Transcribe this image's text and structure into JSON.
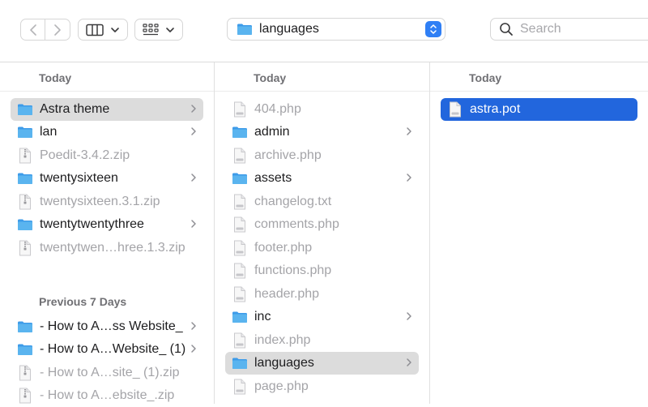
{
  "toolbar": {
    "path_label": "languages",
    "search_placeholder": "Search"
  },
  "columns": [
    {
      "header": "Today",
      "group_title": "Previous 7 Days",
      "items": [
        {
          "label": "Astra theme",
          "type": "folder"
        },
        {
          "label": "lan",
          "type": "folder"
        },
        {
          "label": "Poedit-3.4.2.zip",
          "type": "zip"
        },
        {
          "label": "twentysixteen",
          "type": "folder"
        },
        {
          "label": "twentysixteen.3.1.zip",
          "type": "zip"
        },
        {
          "label": "twentytwentythree",
          "type": "folder"
        },
        {
          "label": "twentytwen…hree.1.3.zip",
          "type": "zip"
        },
        {
          "label": "- How to A…ss Website_",
          "type": "folder"
        },
        {
          "label": "- How to A…Website_ (1)",
          "type": "folder"
        },
        {
          "label": "- How to A…site_ (1).zip",
          "type": "zip"
        },
        {
          "label": "- How to A…ebsite_.zip",
          "type": "zip"
        }
      ]
    },
    {
      "header": "Today",
      "items": [
        {
          "label": "404.php",
          "type": "file"
        },
        {
          "label": "admin",
          "type": "folder"
        },
        {
          "label": "archive.php",
          "type": "file"
        },
        {
          "label": "assets",
          "type": "folder"
        },
        {
          "label": "changelog.txt",
          "type": "file"
        },
        {
          "label": "comments.php",
          "type": "file"
        },
        {
          "label": "footer.php",
          "type": "file"
        },
        {
          "label": "functions.php",
          "type": "file"
        },
        {
          "label": "header.php",
          "type": "file"
        },
        {
          "label": "inc",
          "type": "folder"
        },
        {
          "label": "index.php",
          "type": "file"
        },
        {
          "label": "languages",
          "type": "folder"
        },
        {
          "label": "page.php",
          "type": "file"
        }
      ]
    },
    {
      "header": "Today",
      "items": [
        {
          "label": "astra.pot",
          "type": "file"
        }
      ]
    }
  ],
  "colors": {
    "folder": "#5ab4ef",
    "selection_active": "#2266dd",
    "selection_inactive": "#dcdcdc",
    "accent": "#2f7ff5"
  }
}
